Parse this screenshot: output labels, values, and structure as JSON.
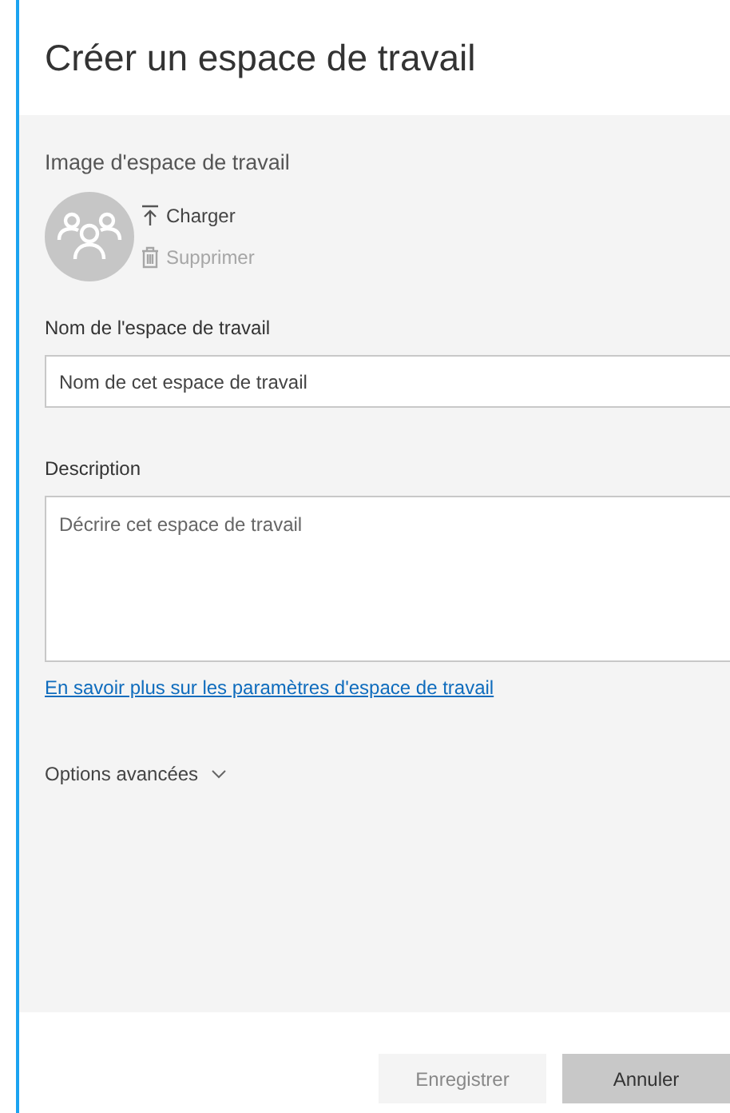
{
  "dialog": {
    "title": "Créer un espace de travail"
  },
  "image_section": {
    "label": "Image d'espace de travail",
    "actions": [
      {
        "label": "Charger",
        "kind": "upload",
        "disabled": false
      },
      {
        "label": "Supprimer",
        "kind": "delete",
        "disabled": true
      }
    ]
  },
  "name_field": {
    "label": "Nom de l'espace de travail",
    "placeholder": "Nom de cet espace de travail"
  },
  "description_field": {
    "label": "Description",
    "placeholder": "Décrire cet espace de travail"
  },
  "learn_more_link": "En savoir plus sur les paramètres d'espace de travail",
  "advanced_options": {
    "label": "Options avancées",
    "expanded": false
  },
  "buttons": [
    {
      "label": "Enregistrer",
      "kind": "primary",
      "disabled": true
    },
    {
      "label": "Annuler",
      "kind": "secondary",
      "disabled": false
    }
  ]
}
